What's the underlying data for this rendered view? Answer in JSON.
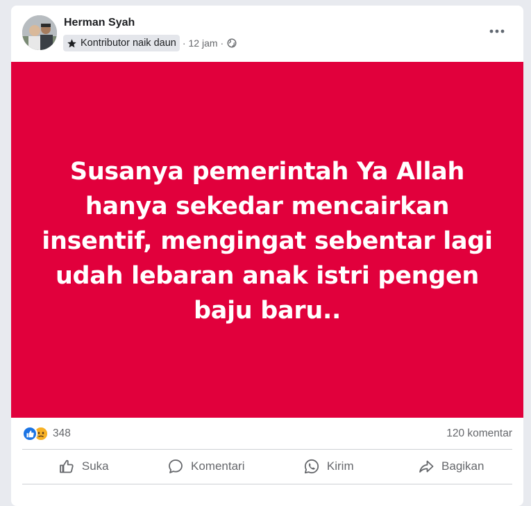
{
  "post": {
    "author": "Herman Syah",
    "badge_label": "Kontributor naik daun",
    "time": "12 jam",
    "separator": "·",
    "text": "Susanya pemerintah Ya Allah hanya sekedar mencairkan insentif, mengingat sebentar lagi udah lebaran anak istri pengen baju baru..",
    "image_background": "#e1003c"
  },
  "stats": {
    "reaction_count": "348",
    "reactions": [
      "like",
      "sad"
    ],
    "comment_count": "120 komentar"
  },
  "actions": {
    "like": "Suka",
    "comment": "Komentari",
    "send": "Kirim",
    "share": "Bagikan"
  },
  "colors": {
    "accent": "#1b74e4",
    "secondary_text": "#65676b"
  }
}
